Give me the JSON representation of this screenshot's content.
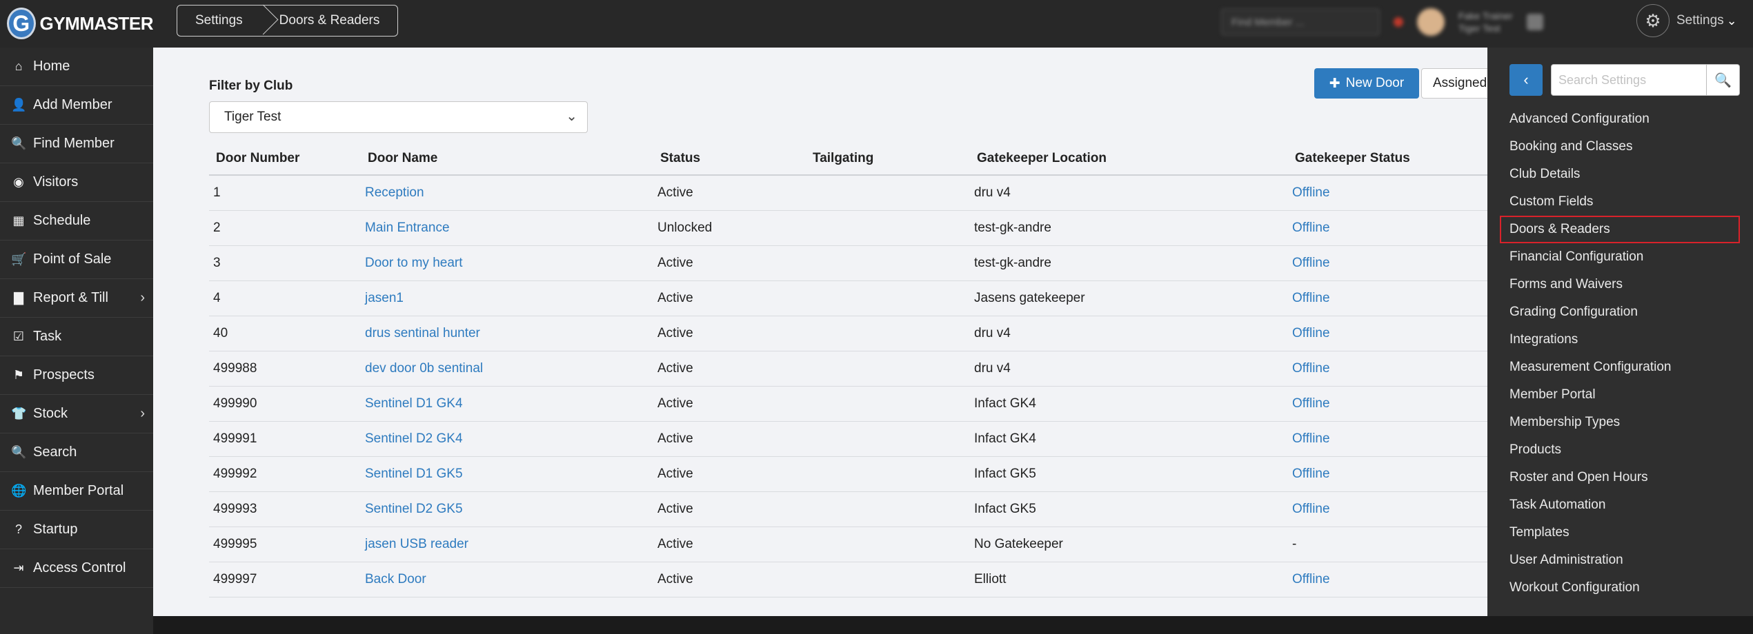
{
  "app": {
    "logo_letter": "G",
    "logo_text": "GYMMASTER"
  },
  "breadcrumb": [
    "Settings",
    "Doors & Readers"
  ],
  "header_blurred": {
    "search_placeholder": "Find Member ...",
    "user_name": "Fake Trainer",
    "user_sub": "Tiger Test"
  },
  "header": {
    "settings_label": "Settings"
  },
  "sidebar": {
    "items": [
      {
        "label": "Home",
        "icon": "home-icon",
        "glyph": "⌂",
        "has_children": false
      },
      {
        "label": "Add Member",
        "icon": "user-icon",
        "glyph": "👤",
        "has_children": false
      },
      {
        "label": "Find Member",
        "icon": "search-icon",
        "glyph": "🔍",
        "has_children": false
      },
      {
        "label": "Visitors",
        "icon": "visitor-icon",
        "glyph": "◉",
        "has_children": false
      },
      {
        "label": "Schedule",
        "icon": "calendar-icon",
        "glyph": "▦",
        "has_children": false
      },
      {
        "label": "Point of Sale",
        "icon": "cart-icon",
        "glyph": "🛒",
        "has_children": false
      },
      {
        "label": "Report & Till",
        "icon": "chart-icon",
        "glyph": "▇",
        "has_children": true
      },
      {
        "label": "Task",
        "icon": "checkbox-icon",
        "glyph": "☑",
        "has_children": false
      },
      {
        "label": "Prospects",
        "icon": "flag-icon",
        "glyph": "⚑",
        "has_children": false
      },
      {
        "label": "Stock",
        "icon": "shirt-icon",
        "glyph": "👕",
        "has_children": true
      },
      {
        "label": "Search",
        "icon": "search-icon",
        "glyph": "🔍",
        "has_children": false
      },
      {
        "label": "Member Portal",
        "icon": "globe-icon",
        "glyph": "🌐",
        "has_children": false
      },
      {
        "label": "Startup",
        "icon": "help-icon",
        "glyph": "?",
        "has_children": false
      },
      {
        "label": "Access Control",
        "icon": "logout-icon",
        "glyph": "⇥",
        "has_children": false
      }
    ]
  },
  "filter": {
    "label": "Filter by Club",
    "selected": "Tiger Test"
  },
  "actions": {
    "new_door": "New Door",
    "assigned": "Assigned"
  },
  "table": {
    "headers": [
      "Door Number",
      "Door Name",
      "Status",
      "Tailgating",
      "Gatekeeper Location",
      "Gatekeeper Status"
    ],
    "rows": [
      {
        "number": "1",
        "name": "Reception",
        "status": "Active",
        "tailgating": "",
        "location": "dru v4",
        "gk_status": "Offline"
      },
      {
        "number": "2",
        "name": "Main Entrance",
        "status": "Unlocked",
        "tailgating": "",
        "location": "test-gk-andre",
        "gk_status": "Offline"
      },
      {
        "number": "3",
        "name": "Door to my heart",
        "status": "Active",
        "tailgating": "",
        "location": "test-gk-andre",
        "gk_status": "Offline"
      },
      {
        "number": "4",
        "name": "jasen1",
        "status": "Active",
        "tailgating": "",
        "location": "Jasens gatekeeper",
        "gk_status": "Offline"
      },
      {
        "number": "40",
        "name": "drus sentinal hunter",
        "status": "Active",
        "tailgating": "",
        "location": "dru v4",
        "gk_status": "Offline"
      },
      {
        "number": "499988",
        "name": "dev door 0b sentinal",
        "status": "Active",
        "tailgating": "",
        "location": "dru v4",
        "gk_status": "Offline"
      },
      {
        "number": "499990",
        "name": "Sentinel D1 GK4",
        "status": "Active",
        "tailgating": "",
        "location": "Infact GK4",
        "gk_status": "Offline"
      },
      {
        "number": "499991",
        "name": "Sentinel D2 GK4",
        "status": "Active",
        "tailgating": "",
        "location": "Infact GK4",
        "gk_status": "Offline"
      },
      {
        "number": "499992",
        "name": "Sentinel D1 GK5",
        "status": "Active",
        "tailgating": "",
        "location": "Infact GK5",
        "gk_status": "Offline"
      },
      {
        "number": "499993",
        "name": "Sentinel D2 GK5",
        "status": "Active",
        "tailgating": "",
        "location": "Infact GK5",
        "gk_status": "Offline"
      },
      {
        "number": "499995",
        "name": "jasen USB reader",
        "status": "Active",
        "tailgating": "",
        "location": "No Gatekeeper",
        "gk_status": "-"
      },
      {
        "number": "499997",
        "name": "Back Door",
        "status": "Active",
        "tailgating": "",
        "location": "Elliott",
        "gk_status": "Offline"
      }
    ]
  },
  "settings_drawer": {
    "search_placeholder": "Search Settings",
    "active_index": 4,
    "items": [
      "Advanced Configuration",
      "Booking and Classes",
      "Club Details",
      "Custom Fields",
      "Doors & Readers",
      "Financial Configuration",
      "Forms and Waivers",
      "Grading Configuration",
      "Integrations",
      "Measurement Configuration",
      "Member Portal",
      "Membership Types",
      "Products",
      "Roster and Open Hours",
      "Task Automation",
      "Templates",
      "User Administration",
      "Workout Configuration"
    ]
  },
  "colors": {
    "accent": "#2e7bbf",
    "highlight_border": "#d9222a",
    "sidebar_bg": "#2b2b2b",
    "drawer_bg": "#2f2f2f"
  }
}
